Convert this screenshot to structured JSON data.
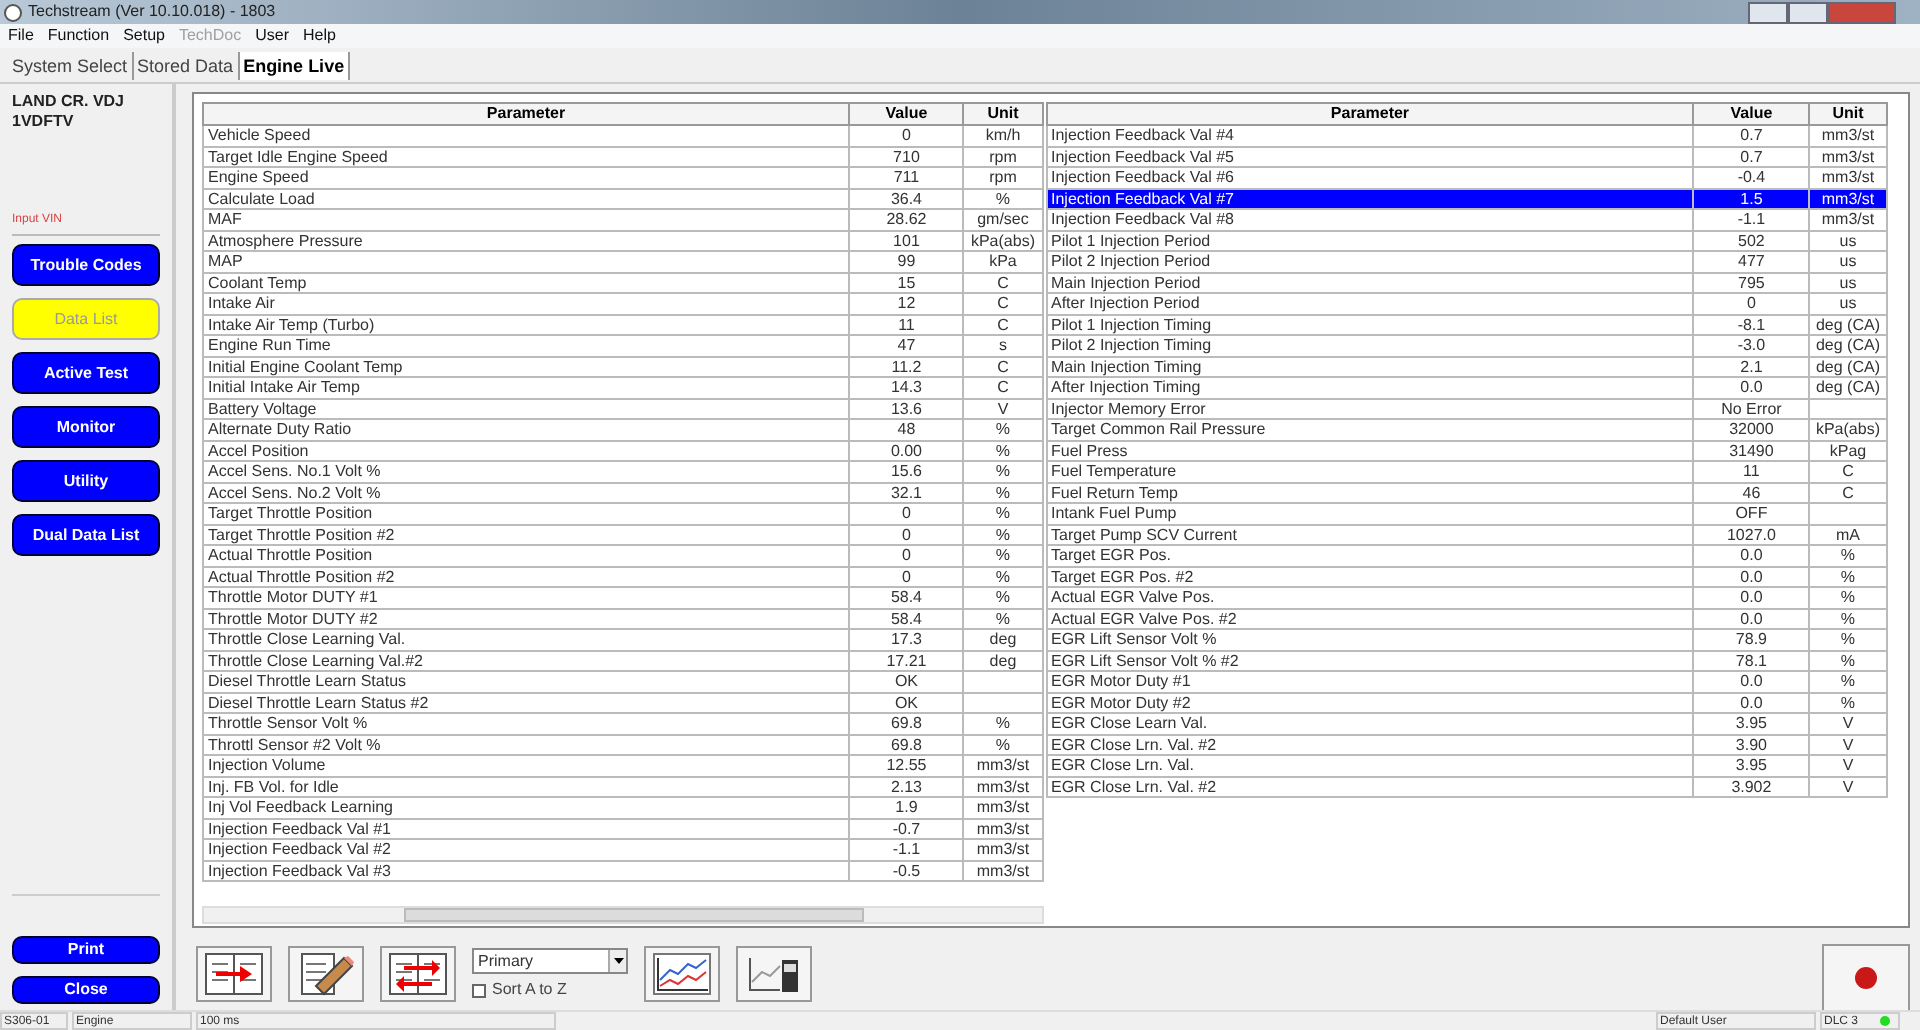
{
  "window": {
    "title": "Techstream (Ver 10.10.018) - 1803"
  },
  "menu": [
    {
      "label": "File",
      "disabled": false
    },
    {
      "label": "Function",
      "disabled": false
    },
    {
      "label": "Setup",
      "disabled": false
    },
    {
      "label": "TechDoc",
      "disabled": true
    },
    {
      "label": "User",
      "disabled": false
    },
    {
      "label": "Help",
      "disabled": false
    }
  ],
  "tabs": [
    {
      "label": "System Select",
      "selected": false
    },
    {
      "label": "Stored Data",
      "selected": false
    },
    {
      "label": "Engine Live",
      "selected": true
    }
  ],
  "sidebar": {
    "vehicle": [
      "LAND CR. VDJ",
      "1VDFTV"
    ],
    "vin_link": "Input VIN",
    "items": [
      {
        "label": "Trouble Codes",
        "selected": false
      },
      {
        "label": "Data List",
        "selected": true
      },
      {
        "label": "Active Test",
        "selected": false
      },
      {
        "label": "Monitor",
        "selected": false
      },
      {
        "label": "Utility",
        "selected": false
      },
      {
        "label": "Dual Data List",
        "selected": false
      }
    ],
    "bottom_buttons": [
      "Print",
      "Close"
    ]
  },
  "tables": [
    {
      "columns": [
        "Parameter",
        "Value",
        "Unit"
      ],
      "rows": [
        {
          "cells": [
            "Vehicle Speed",
            "0",
            "km/h"
          ],
          "selected": false
        },
        {
          "cells": [
            "Target Idle Engine Speed",
            "710",
            "rpm"
          ],
          "selected": false
        },
        {
          "cells": [
            "Engine Speed",
            "711",
            "rpm"
          ],
          "selected": false
        },
        {
          "cells": [
            "Calculate Load",
            "36.4",
            "%"
          ],
          "selected": false
        },
        {
          "cells": [
            "MAF",
            "28.62",
            "gm/sec"
          ],
          "selected": false
        },
        {
          "cells": [
            "Atmosphere Pressure",
            "101",
            "kPa(abs)"
          ],
          "selected": false
        },
        {
          "cells": [
            "MAP",
            "99",
            "kPa"
          ],
          "selected": false
        },
        {
          "cells": [
            "Coolant Temp",
            "15",
            "C"
          ],
          "selected": false
        },
        {
          "cells": [
            "Intake Air",
            "12",
            "C"
          ],
          "selected": false
        },
        {
          "cells": [
            "Intake Air Temp (Turbo)",
            "11",
            "C"
          ],
          "selected": false
        },
        {
          "cells": [
            "Engine Run Time",
            "47",
            "s"
          ],
          "selected": false
        },
        {
          "cells": [
            "Initial Engine Coolant Temp",
            "11.2",
            "C"
          ],
          "selected": false
        },
        {
          "cells": [
            "Initial Intake Air Temp",
            "14.3",
            "C"
          ],
          "selected": false
        },
        {
          "cells": [
            "Battery Voltage",
            "13.6",
            "V"
          ],
          "selected": false
        },
        {
          "cells": [
            "Alternate Duty Ratio",
            "48",
            "%"
          ],
          "selected": false
        },
        {
          "cells": [
            "Accel Position",
            "0.00",
            "%"
          ],
          "selected": false
        },
        {
          "cells": [
            "Accel Sens. No.1 Volt %",
            "15.6",
            "%"
          ],
          "selected": false
        },
        {
          "cells": [
            "Accel Sens. No.2 Volt %",
            "32.1",
            "%"
          ],
          "selected": false
        },
        {
          "cells": [
            "Target Throttle Position",
            "0",
            "%"
          ],
          "selected": false
        },
        {
          "cells": [
            "Target Throttle Position #2",
            "0",
            "%"
          ],
          "selected": false
        },
        {
          "cells": [
            "Actual Throttle Position",
            "0",
            "%"
          ],
          "selected": false
        },
        {
          "cells": [
            "Actual Throttle Position #2",
            "0",
            "%"
          ],
          "selected": false
        },
        {
          "cells": [
            "Throttle Motor DUTY #1",
            "58.4",
            "%"
          ],
          "selected": false
        },
        {
          "cells": [
            "Throttle Motor DUTY #2",
            "58.4",
            "%"
          ],
          "selected": false
        },
        {
          "cells": [
            "Throttle Close Learning Val.",
            "17.3",
            "deg"
          ],
          "selected": false
        },
        {
          "cells": [
            "Throttle Close Learning Val.#2",
            "17.21",
            "deg"
          ],
          "selected": false
        },
        {
          "cells": [
            "Diesel Throttle Learn Status",
            "OK",
            ""
          ],
          "selected": false
        },
        {
          "cells": [
            "Diesel Throttle Learn Status #2",
            "OK",
            ""
          ],
          "selected": false
        },
        {
          "cells": [
            "Throttle Sensor Volt %",
            "69.8",
            "%"
          ],
          "selected": false
        },
        {
          "cells": [
            "Throttl Sensor #2 Volt %",
            "69.8",
            "%"
          ],
          "selected": false
        },
        {
          "cells": [
            "Injection Volume",
            "12.55",
            "mm3/st"
          ],
          "selected": false
        },
        {
          "cells": [
            "Inj. FB Vol. for Idle",
            "2.13",
            "mm3/st"
          ],
          "selected": false
        },
        {
          "cells": [
            "Inj Vol Feedback Learning",
            "1.9",
            "mm3/st"
          ],
          "selected": false
        },
        {
          "cells": [
            "Injection Feedback Val #1",
            "-0.7",
            "mm3/st"
          ],
          "selected": false
        },
        {
          "cells": [
            "Injection Feedback Val #2",
            "-1.1",
            "mm3/st"
          ],
          "selected": false
        },
        {
          "cells": [
            "Injection Feedback Val #3",
            "-0.5",
            "mm3/st"
          ],
          "selected": false
        }
      ]
    },
    {
      "columns": [
        "Parameter",
        "Value",
        "Unit"
      ],
      "rows": [
        {
          "cells": [
            "Injection Feedback Val #4",
            "0.7",
            "mm3/st"
          ],
          "selected": false
        },
        {
          "cells": [
            "Injection Feedback Val #5",
            "0.7",
            "mm3/st"
          ],
          "selected": false
        },
        {
          "cells": [
            "Injection Feedback Val #6",
            "-0.4",
            "mm3/st"
          ],
          "selected": false
        },
        {
          "cells": [
            "Injection Feedback Val #7",
            "1.5",
            "mm3/st"
          ],
          "selected": true
        },
        {
          "cells": [
            "Injection Feedback Val #8",
            "-1.1",
            "mm3/st"
          ],
          "selected": false
        },
        {
          "cells": [
            "Pilot 1 Injection Period",
            "502",
            "us"
          ],
          "selected": false
        },
        {
          "cells": [
            "Pilot 2 Injection Period",
            "477",
            "us"
          ],
          "selected": false
        },
        {
          "cells": [
            "Main Injection Period",
            "795",
            "us"
          ],
          "selected": false
        },
        {
          "cells": [
            "After Injection Period",
            "0",
            "us"
          ],
          "selected": false
        },
        {
          "cells": [
            "Pilot 1 Injection Timing",
            "-8.1",
            "deg (CA)"
          ],
          "selected": false
        },
        {
          "cells": [
            "Pilot 2 Injection Timing",
            "-3.0",
            "deg (CA)"
          ],
          "selected": false
        },
        {
          "cells": [
            "Main Injection Timing",
            "2.1",
            "deg (CA)"
          ],
          "selected": false
        },
        {
          "cells": [
            "After Injection Timing",
            "0.0",
            "deg (CA)"
          ],
          "selected": false
        },
        {
          "cells": [
            "Injector Memory Error",
            "No Error",
            ""
          ],
          "selected": false
        },
        {
          "cells": [
            "Target Common Rail Pressure",
            "32000",
            "kPa(abs)"
          ],
          "selected": false
        },
        {
          "cells": [
            "Fuel Press",
            "31490",
            "kPag"
          ],
          "selected": false
        },
        {
          "cells": [
            "Fuel Temperature",
            "11",
            "C"
          ],
          "selected": false
        },
        {
          "cells": [
            "Fuel Return Temp",
            "46",
            "C"
          ],
          "selected": false
        },
        {
          "cells": [
            "Intank Fuel Pump",
            "OFF",
            ""
          ],
          "selected": false
        },
        {
          "cells": [
            "Target Pump SCV Current",
            "1027.0",
            "mA"
          ],
          "selected": false
        },
        {
          "cells": [
            "Target EGR Pos.",
            "0.0",
            "%"
          ],
          "selected": false
        },
        {
          "cells": [
            "Target EGR Pos. #2",
            "0.0",
            "%"
          ],
          "selected": false
        },
        {
          "cells": [
            "Actual EGR Valve Pos.",
            "0.0",
            "%"
          ],
          "selected": false
        },
        {
          "cells": [
            "Actual EGR Valve Pos. #2",
            "0.0",
            "%"
          ],
          "selected": false
        },
        {
          "cells": [
            "EGR Lift Sensor Volt %",
            "78.9",
            "%"
          ],
          "selected": false
        },
        {
          "cells": [
            "EGR Lift Sensor Volt % #2",
            "78.1",
            "%"
          ],
          "selected": false
        },
        {
          "cells": [
            "EGR Motor Duty #1",
            "0.0",
            "%"
          ],
          "selected": false
        },
        {
          "cells": [
            "EGR Motor Duty #2",
            "0.0",
            "%"
          ],
          "selected": false
        },
        {
          "cells": [
            "EGR Close Learn Val.",
            "3.95",
            "V"
          ],
          "selected": false
        },
        {
          "cells": [
            "EGR Close Lrn. Val. #2",
            "3.90",
            "V"
          ],
          "selected": false
        },
        {
          "cells": [
            "EGR Close Lrn. Val.",
            "3.95",
            "V"
          ],
          "selected": false
        },
        {
          "cells": [
            "EGR Close Lrn. Val. #2",
            "3.902",
            "V"
          ],
          "selected": false
        }
      ]
    }
  ],
  "toolbar": {
    "dropdown": "Primary",
    "sort": {
      "label": "Sort A to Z",
      "checked": false
    }
  },
  "status_bar": [
    "S306-01",
    "Engine",
    "100 ms",
    "Default User",
    "DLC 3"
  ]
}
